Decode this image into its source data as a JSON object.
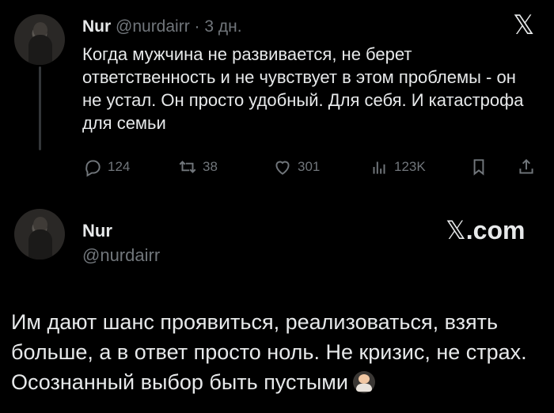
{
  "tweet1": {
    "author_name": "Nur",
    "author_handle": "@nurdairr",
    "separator": "·",
    "time_ago": "3 дн.",
    "text": "Когда мужчина не развивается, не берет ответственность и не чувствует в этом проблемы - он не устал. Он просто удобный. Для себя. И катастрофа для семьи",
    "actions": {
      "replies": "124",
      "retweets": "38",
      "likes": "301",
      "views": "123K"
    }
  },
  "logo": {
    "x_symbol": "𝕏",
    "xcom_suffix": ".com"
  },
  "tweet2": {
    "author_name": "Nur",
    "author_handle": "@nurdairr",
    "text": "Им дают шанс проявиться, реализоваться, взять больше, а в ответ просто ноль. Не кризис, не страх. Осознанный выбор быть пустыми"
  },
  "icons": {
    "reply": "reply-icon",
    "retweet": "retweet-icon",
    "like": "heart-icon",
    "views": "views-chart-icon",
    "bookmark": "bookmark-icon",
    "share": "share-icon"
  },
  "colors": {
    "background": "#000000",
    "text": "#e7e9ea",
    "muted": "#71767b"
  }
}
